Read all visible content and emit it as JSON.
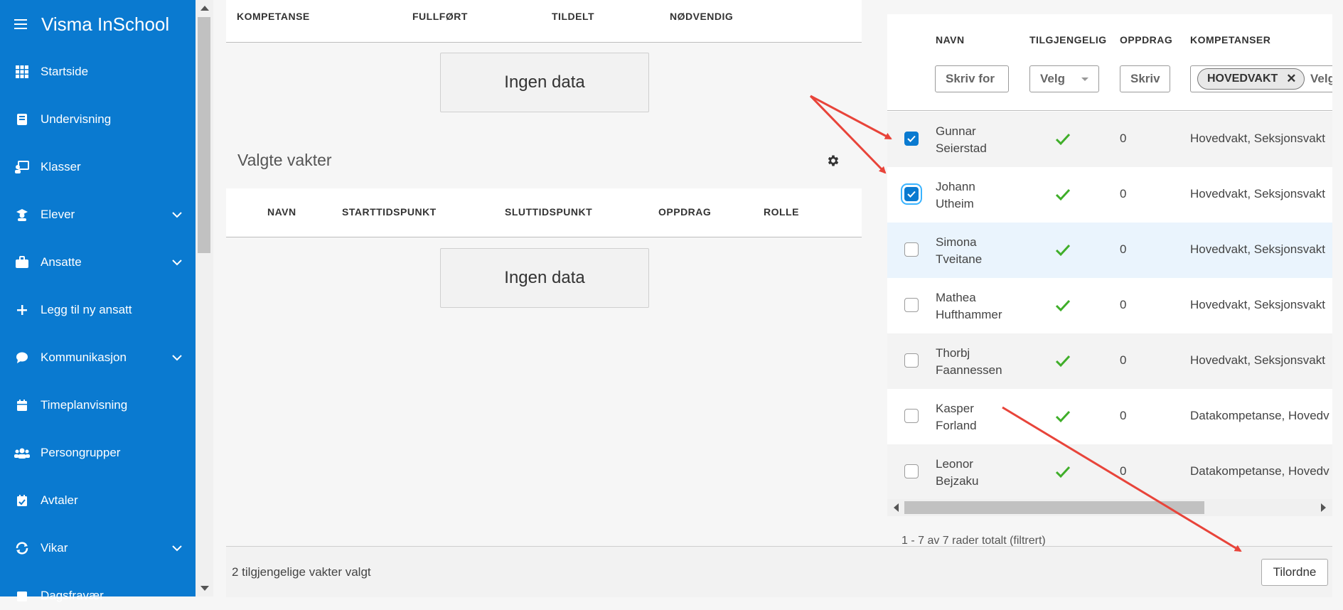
{
  "app": {
    "title": "Visma InSchool"
  },
  "sidebar": {
    "items": [
      {
        "label": "Startside",
        "icon": "grid-icon",
        "chevron": false
      },
      {
        "label": "Undervisning",
        "icon": "book-icon",
        "chevron": false
      },
      {
        "label": "Klasser",
        "icon": "class-icon",
        "chevron": false
      },
      {
        "label": "Elever",
        "icon": "student-icon",
        "chevron": true
      },
      {
        "label": "Ansatte",
        "icon": "briefcase-icon",
        "chevron": true
      },
      {
        "label": "Legg til ny ansatt",
        "icon": "plus-icon",
        "chevron": false
      },
      {
        "label": "Kommunikasjon",
        "icon": "chat-icon",
        "chevron": true
      },
      {
        "label": "Timeplanvisning",
        "icon": "calendar-icon",
        "chevron": false
      },
      {
        "label": "Persongrupper",
        "icon": "group-icon",
        "chevron": false
      },
      {
        "label": "Avtaler",
        "icon": "calendar-check-icon",
        "chevron": false
      },
      {
        "label": "Vikar",
        "icon": "swap-icon",
        "chevron": true
      },
      {
        "label": "Dagsfravær",
        "icon": "absence-icon",
        "chevron": false
      }
    ]
  },
  "top_table": {
    "headers": [
      "KOMPETANSE",
      "FULLFØRT",
      "TILDELT",
      "NØDVENDIG"
    ],
    "empty_text": "Ingen data"
  },
  "selected_shifts": {
    "title": "Valgte vakter",
    "headers": [
      "NAVN",
      "STARTTIDSPUNKT",
      "SLUTTIDSPUNKT",
      "OPPDRAG",
      "ROLLE"
    ],
    "empty_text": "Ingen data"
  },
  "available": {
    "headers": [
      "NAVN",
      "TILGJENGELIG",
      "OPPDRAG",
      "KOMPETANSER"
    ],
    "filters": {
      "name_placeholder": "Skriv for",
      "available_placeholder": "Velg",
      "assignments_placeholder": "Skriv",
      "competence_chip": "HOVEDVAKT",
      "competence_placeholder": "Velg"
    },
    "rows": [
      {
        "first": "Gunnar",
        "last": "Seierstad",
        "available": true,
        "assignments": "0",
        "competences": "Hovedvakt, Seksjonsvakt",
        "checked": true,
        "focus": false,
        "bg": "#f3f3f3"
      },
      {
        "first": "Johann",
        "last": "Utheim",
        "available": true,
        "assignments": "0",
        "competences": "Hovedvakt, Seksjonsvakt",
        "checked": true,
        "focus": true,
        "bg": "#ffffff"
      },
      {
        "first": "Simona",
        "last": "Tveitane",
        "available": true,
        "assignments": "0",
        "competences": "Hovedvakt, Seksjonsvakt",
        "checked": false,
        "focus": false,
        "bg": "#eaf4fd"
      },
      {
        "first": "Mathea",
        "last": "Hufthammer",
        "available": true,
        "assignments": "0",
        "competences": "Hovedvakt, Seksjonsvakt",
        "checked": false,
        "focus": false,
        "bg": "#ffffff"
      },
      {
        "first": "Thorbj",
        "last": "Faannessen",
        "available": true,
        "assignments": "0",
        "competences": "Hovedvakt, Seksjonsvakt",
        "checked": false,
        "focus": false,
        "bg": "#f3f3f3"
      },
      {
        "first": "Kasper",
        "last": "Forland",
        "available": true,
        "assignments": "0",
        "competences": "Datakompetanse, Hovedv",
        "checked": false,
        "focus": false,
        "bg": "#ffffff"
      },
      {
        "first": "Leonor",
        "last": "Bejzaku",
        "available": true,
        "assignments": "0",
        "competences": "Datakompetanse, Hovedv",
        "checked": false,
        "focus": false,
        "bg": "#f3f3f3"
      }
    ],
    "rows_info": "1 - 7 av 7 rader totalt (filtrert)"
  },
  "footer": {
    "status": "2 tilgjengelige vakter valgt",
    "assign_button": "Tilordne"
  },
  "colors": {
    "sidebar": "#0a7ad0",
    "check": "#3fae29",
    "annotation_arrow": "#e8443a"
  }
}
